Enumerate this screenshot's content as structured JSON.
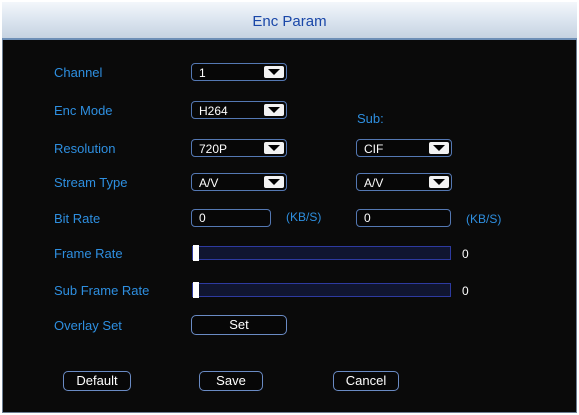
{
  "window": {
    "title": "Enc Param"
  },
  "labels": {
    "channel": "Channel",
    "enc_mode": "Enc Mode",
    "sub": "Sub:",
    "resolution": "Resolution",
    "stream_type": "Stream Type",
    "bit_rate": "Bit Rate",
    "frame_rate": "Frame Rate",
    "sub_frame_rate": "Sub Frame Rate",
    "overlay_set": "Overlay Set"
  },
  "main": {
    "channel": "1",
    "enc_mode": "H264",
    "resolution": "720P",
    "stream_type": "A/V",
    "bit_rate": "0",
    "bit_rate_unit": "(KB/S)",
    "frame_rate_value": "0",
    "frame_rate_level": 0
  },
  "sub": {
    "resolution": "CIF",
    "stream_type": "A/V",
    "bit_rate": "0",
    "bit_rate_unit": "(KB/S)",
    "frame_rate_value": "0",
    "frame_rate_level": 0
  },
  "buttons": {
    "set": "Set",
    "default": "Default",
    "save": "Save",
    "cancel": "Cancel"
  },
  "colors": {
    "label": "#2e8fe0",
    "title": "#1a47a8",
    "background": "#0a0a0a",
    "border": "#5478b3"
  },
  "icons": {
    "dropdown": "chevron-down-icon"
  }
}
